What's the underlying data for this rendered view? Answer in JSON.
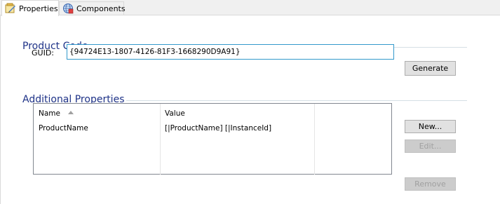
{
  "tabs": [
    {
      "label": "Properties",
      "icon": "properties-icon",
      "active": true
    },
    {
      "label": "Components",
      "icon": "components-globe-icon",
      "active": false
    }
  ],
  "product_code": {
    "title": "Product Code",
    "guid_label": "GUID:",
    "guid_value": "{94724E13-1807-4126-81F3-1668290D9A91}",
    "generate_label": "Generate"
  },
  "additional_properties": {
    "title": "Additional Properties",
    "columns": [
      "Name",
      "Value"
    ],
    "sort_column": "Name",
    "rows": [
      {
        "name": "ProductName",
        "value": "[|ProductName] [|InstanceId]"
      }
    ],
    "new_label": "New...",
    "edit_label": "Edit...",
    "remove_label": "Remove"
  },
  "colors": {
    "section_title": "#1e3287",
    "input_border": "#3399cc"
  }
}
